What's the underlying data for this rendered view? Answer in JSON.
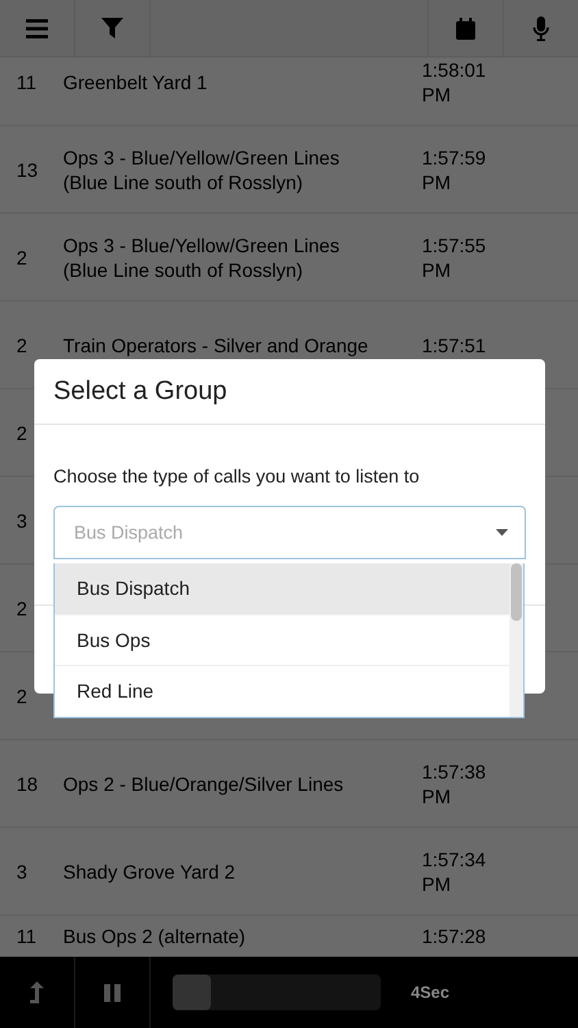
{
  "toolbar": {
    "buttons": [
      {
        "kind": "menu"
      },
      {
        "kind": "filter"
      },
      {
        "kind": "spacer"
      },
      {
        "kind": "calendar"
      },
      {
        "kind": "mic"
      }
    ]
  },
  "calls": [
    {
      "count": "11",
      "name": "Greenbelt Yard 1",
      "time": "1:58:01 PM"
    },
    {
      "count": "13",
      "name": "Ops 3 - Blue/Yellow/Green Lines (Blue Line south of Rosslyn)",
      "time": "1:57:59 PM"
    },
    {
      "count": "2",
      "name": "Ops 3 - Blue/Yellow/Green Lines (Blue Line south of Rosslyn)",
      "time": "1:57:55 PM"
    },
    {
      "count": "2",
      "name": "Train Operators - Silver and Orange",
      "time": "1:57:51"
    },
    {
      "count": "2"
    },
    {
      "count": "3"
    },
    {
      "count": "2"
    },
    {
      "count": "2"
    },
    {
      "count": "18",
      "name": "Ops 2 - Blue/Orange/Silver Lines",
      "time": "1:57:38 PM"
    },
    {
      "count": "3",
      "name": "Shady Grove Yard 2",
      "time": "1:57:34 PM"
    },
    {
      "count": "11",
      "name": "Bus Ops 2 (alternate)",
      "time": "1:57:28"
    }
  ],
  "player": {
    "progress": {
      "level": 0
    },
    "interval": "4Sec"
  },
  "dialog": {
    "title": "Select a Group",
    "prompt": "Choose the type of calls you want to listen to",
    "select": {
      "value": "Bus Dispatch"
    },
    "options": [
      {
        "label": "Bus Dispatch",
        "selected": true
      },
      {
        "label": "Bus Ops",
        "selected": false
      },
      {
        "label": "Red Line",
        "selected": false
      }
    ]
  }
}
